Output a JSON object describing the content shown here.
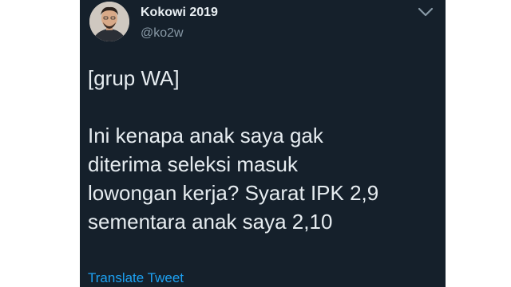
{
  "tweet": {
    "author": {
      "display_name": "Kokowi 2019",
      "handle": "@ko2w",
      "avatar_icon": "profile-photo"
    },
    "menu_icon": "chevron-down-icon",
    "body_lines": [
      "[grup WA]",
      "Ini kenapa anak saya gak",
      "diterima seleksi masuk",
      "lowongan kerja? Syarat IPK 2,9",
      "sementara anak saya 2,10"
    ],
    "translate_label": "Translate Tweet"
  },
  "colors": {
    "card_background": "#15202b",
    "primary_text": "#e6ecf0",
    "secondary_text": "#8899a6",
    "link": "#1da1f2",
    "page_background": "#ffffff"
  }
}
